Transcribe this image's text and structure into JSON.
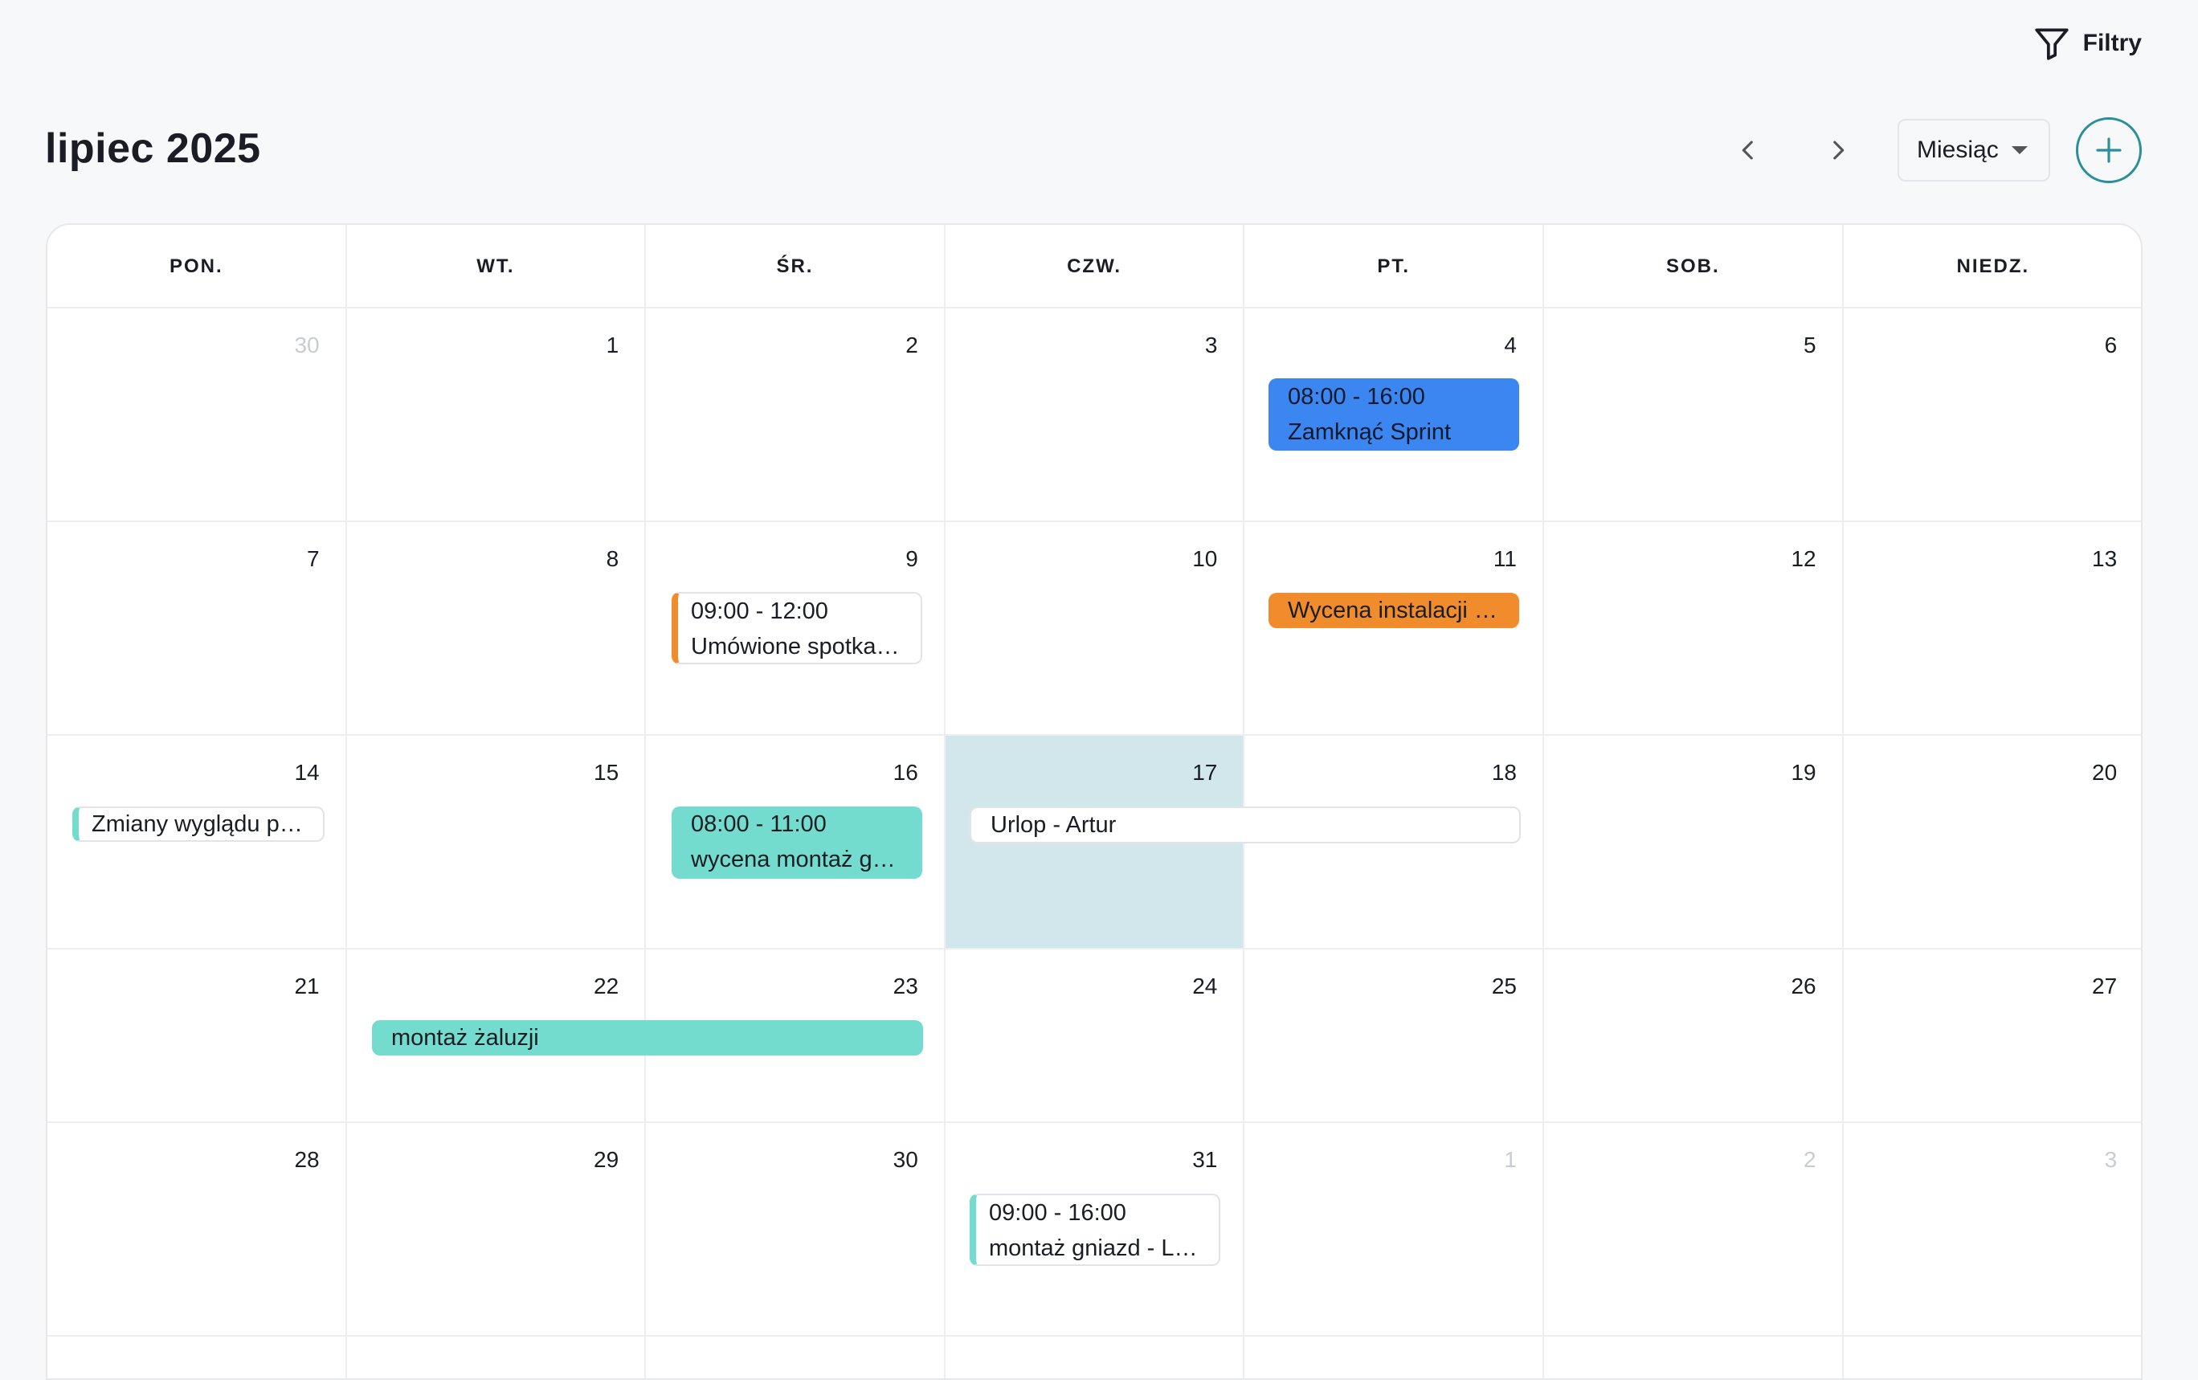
{
  "toolbar": {
    "filters_label": "Filtry",
    "title": "lipiec 2025",
    "view_label": "Miesiąc"
  },
  "calendar": {
    "weekdays": [
      "PON.",
      "WT.",
      "ŚR.",
      "CZW.",
      "PT.",
      "SOB.",
      "NIEDZ."
    ],
    "weeks": [
      [
        "30",
        "1",
        "2",
        "3",
        "4",
        "5",
        "6"
      ],
      [
        "7",
        "8",
        "9",
        "10",
        "11",
        "12",
        "13"
      ],
      [
        "14",
        "15",
        "16",
        "17",
        "18",
        "19",
        "20"
      ],
      [
        "21",
        "22",
        "23",
        "24",
        "25",
        "26",
        "27"
      ],
      [
        "28",
        "29",
        "30",
        "31",
        "1",
        "2",
        "3"
      ]
    ],
    "today": "17"
  },
  "events": {
    "sprint": {
      "time": "08:00 - 16:00",
      "title": "Zamknąć Sprint"
    },
    "meeting": {
      "time": "09:00 - 12:00",
      "title": "Umówione spotkanie"
    },
    "wycena_instalacji": {
      "title": "Wycena instalacji el..."
    },
    "zmiany": {
      "title": "Zmiany wyglądu pa..."
    },
    "wycena_montaz": {
      "time": "08:00 - 11:00",
      "title": "wycena montaż gni..."
    },
    "urlop": {
      "title": "Urlop - Artur"
    },
    "zaluzje": {
      "title": "montaż żaluzji"
    },
    "gniazd": {
      "time": "09:00 - 16:00",
      "title": "montaż gniazd - Lid..."
    }
  },
  "colors": {
    "blue": "#3b86f0",
    "orange": "#f08c2c",
    "teal": "#74dbcf",
    "today_bg": "#d2e7ec",
    "accent": "#2a8f9b"
  }
}
